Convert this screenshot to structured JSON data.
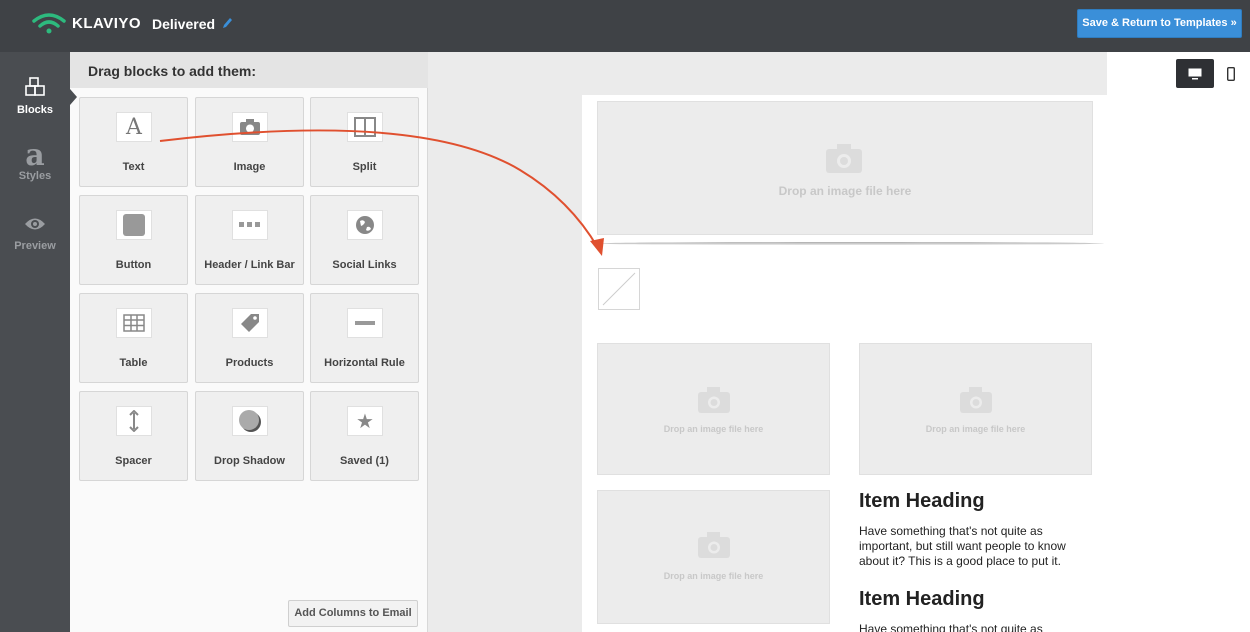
{
  "header": {
    "brand": "KLAVIYO",
    "doc_title": "Delivered",
    "save_button": "Save & Return to Templates »"
  },
  "rail": {
    "items": [
      {
        "label": "Blocks",
        "icon": "blocks-icon",
        "active": true
      },
      {
        "label": "Styles",
        "icon": "styles-icon",
        "active": false
      },
      {
        "label": "Preview",
        "icon": "eye-icon",
        "active": false
      }
    ]
  },
  "panel": {
    "title": "Drag blocks to add them:",
    "blocks": [
      {
        "label": "Text",
        "icon": "text-icon"
      },
      {
        "label": "Image",
        "icon": "camera-icon"
      },
      {
        "label": "Split",
        "icon": "split-icon"
      },
      {
        "label": "Button",
        "icon": "button-icon"
      },
      {
        "label": "Header / Link Bar",
        "icon": "link-bar-icon"
      },
      {
        "label": "Social Links",
        "icon": "globe-icon"
      },
      {
        "label": "Table",
        "icon": "table-icon"
      },
      {
        "label": "Products",
        "icon": "tag-icon"
      },
      {
        "label": "Horizontal Rule",
        "icon": "rule-icon"
      },
      {
        "label": "Spacer",
        "icon": "spacer-icon"
      },
      {
        "label": "Drop Shadow",
        "icon": "drop-shadow-icon"
      },
      {
        "label": "Saved (1)",
        "icon": "star-icon"
      }
    ],
    "add_columns": "Add Columns to Email"
  },
  "canvas": {
    "drop_text": "Drop an image file here",
    "drop_text_small": "Drop an image file here",
    "item_heading_1": "Item Heading",
    "item_body_1": "Have something that's not quite as important, but still want people to know about it? This is a good place to put it.",
    "item_heading_2": "Item Heading",
    "item_body_2": "Have something that's not quite as"
  },
  "colors": {
    "topbar": "#3f4246",
    "rail": "#4a4d51",
    "save_button": "#3a8fd9",
    "drag_arrow": "#e0502f"
  }
}
